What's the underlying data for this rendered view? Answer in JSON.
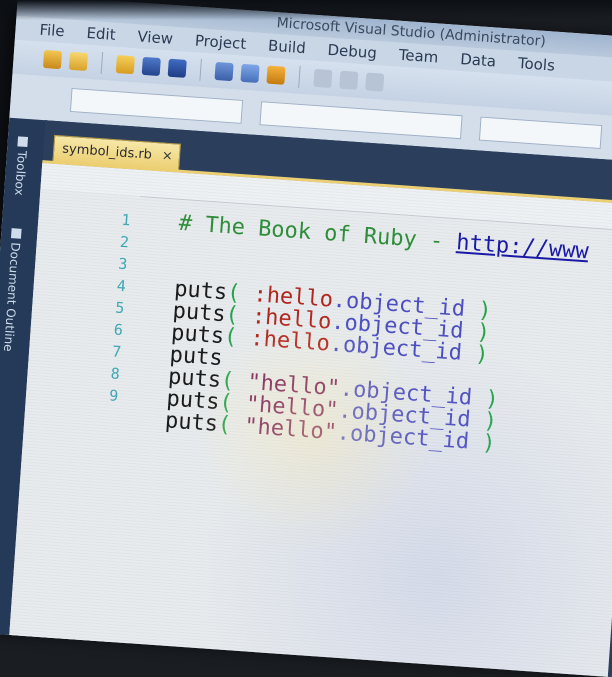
{
  "window": {
    "title": "Microsoft Visual Studio (Administrator)"
  },
  "menu": [
    "File",
    "Edit",
    "View",
    "Project",
    "Build",
    "Debug",
    "Team",
    "Data",
    "Tools"
  ],
  "toolbar": {
    "icons": [
      "new-project-icon",
      "open-file-icon",
      "save-icon",
      "save-all-icon",
      "cut-icon",
      "find-icon",
      "solution-explorer-icon",
      "undo-icon",
      "redo-icon",
      "start-debug-icon"
    ]
  },
  "sidebar": {
    "tabs": [
      {
        "label": "Toolbox",
        "icon": "toolbox-icon"
      },
      {
        "label": "Document Outline",
        "icon": "document-outline-icon"
      }
    ]
  },
  "editor": {
    "tab_label": "symbol_ids.rb",
    "close_glyph": "×",
    "lines": [
      {
        "num": "1",
        "segments": [
          {
            "t": "  # The Book of Ruby - ",
            "c": "comment"
          },
          {
            "t": "http://www",
            "c": "link"
          }
        ]
      },
      {
        "num": "2",
        "segments": []
      },
      {
        "num": "3",
        "segments": []
      },
      {
        "num": "4",
        "segments": [
          {
            "t": "  puts",
            "c": "kw"
          },
          {
            "t": "( ",
            "c": "punct"
          },
          {
            "t": ":hello",
            "c": "sym"
          },
          {
            "t": ".object_id ",
            "c": "meth"
          },
          {
            "t": ")",
            "c": "punct"
          }
        ]
      },
      {
        "num": "5",
        "segments": [
          {
            "t": "  puts",
            "c": "kw"
          },
          {
            "t": "( ",
            "c": "punct"
          },
          {
            "t": ":hello",
            "c": "sym"
          },
          {
            "t": ".object_id ",
            "c": "meth"
          },
          {
            "t": ")",
            "c": "punct"
          }
        ]
      },
      {
        "num": "6",
        "segments": [
          {
            "t": "  puts",
            "c": "kw"
          },
          {
            "t": "( ",
            "c": "punct"
          },
          {
            "t": ":hello",
            "c": "sym"
          },
          {
            "t": ".object_id ",
            "c": "meth"
          },
          {
            "t": ")",
            "c": "punct"
          }
        ]
      },
      {
        "num": "7",
        "segments": [
          {
            "t": "  puts",
            "c": "kw"
          }
        ]
      },
      {
        "num": "8",
        "segments": [
          {
            "t": "  puts",
            "c": "kw"
          },
          {
            "t": "( ",
            "c": "punct"
          },
          {
            "t": "\"hello\"",
            "c": "str"
          },
          {
            "t": ".object_id ",
            "c": "meth"
          },
          {
            "t": ")",
            "c": "punct"
          }
        ]
      },
      {
        "num": "9",
        "segments": [
          {
            "t": "  puts",
            "c": "kw"
          },
          {
            "t": "( ",
            "c": "punct"
          },
          {
            "t": "\"hello\"",
            "c": "str"
          },
          {
            "t": ".object_id ",
            "c": "meth"
          },
          {
            "t": ")",
            "c": "punct"
          }
        ]
      },
      {
        "num": "",
        "segments": [
          {
            "t": "  puts",
            "c": "kw"
          },
          {
            "t": "( ",
            "c": "punct"
          },
          {
            "t": "\"hello\"",
            "c": "str"
          },
          {
            "t": ".object_id ",
            "c": "meth"
          },
          {
            "t": ")",
            "c": "punct"
          }
        ]
      }
    ]
  },
  "colors": {
    "doc_tab": "#eccf72",
    "sidebar": "#243a58",
    "editor_bg": "#e7ebee",
    "line_number": "#3fa9b6",
    "symbol": "#b3261e",
    "string": "#7a1f5a",
    "method": "#4d4fc2",
    "comment": "#2f8f3a"
  }
}
